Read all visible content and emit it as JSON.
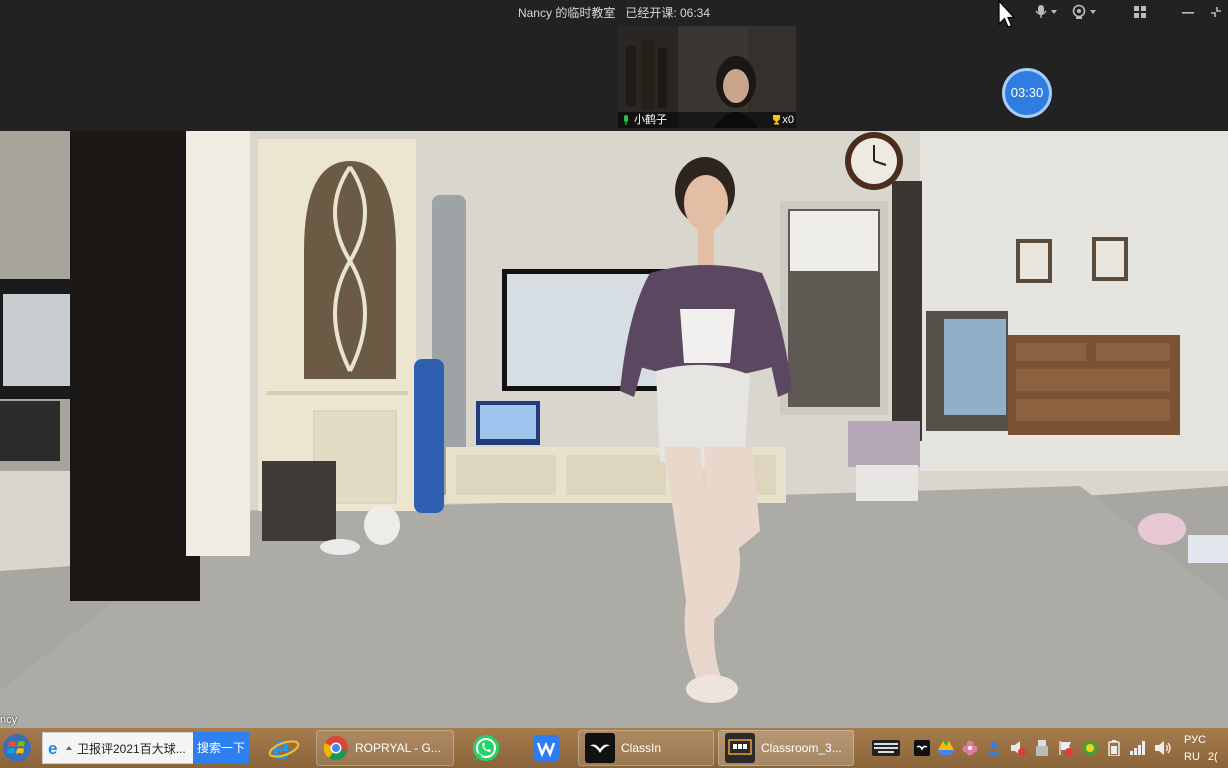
{
  "window": {
    "classroom_title": "Nancy 的临时教室",
    "class_status": "已经开课: 06:34"
  },
  "participant": {
    "name": "小鹤子",
    "trophy_count": "x0"
  },
  "timer": "03:30",
  "video": {
    "teacher_label": "ncy"
  },
  "toolbar_icons": [
    "microphone-icon",
    "camera-icon",
    "grid-layout-icon",
    "minimize-icon",
    "restore-icon"
  ],
  "taskbar": {
    "search": {
      "query": "卫报评2021百大球...",
      "button_label": "搜索一下"
    },
    "apps": [
      {
        "name": "chrome",
        "label": "ROPRYAL - G..."
      },
      {
        "name": "classin",
        "label": "ClassIn"
      },
      {
        "name": "classroom",
        "label": "Classroom_3..."
      }
    ],
    "language": "РУС",
    "locale": "RU",
    "clock_partial": "2("
  },
  "colors": {
    "topbar": "#222222",
    "timer": "#2f7de1",
    "taskbar": "#a57c4e",
    "search_button": "#2e7ff0",
    "mic_active": "#27c24c",
    "trophy": "#f5c518"
  }
}
